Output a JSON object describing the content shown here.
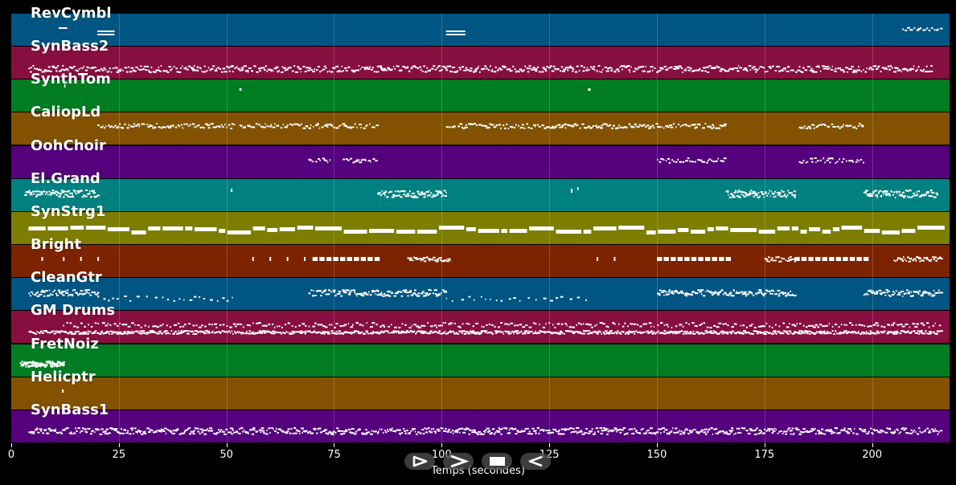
{
  "timeline": {
    "x_axis_label": "Temps (secondes)",
    "x_range": [
      0,
      218
    ],
    "ticks": [
      "0",
      "25",
      "50",
      "75",
      "100",
      "125",
      "150",
      "175",
      "200"
    ],
    "tick_values": [
      0,
      25,
      50,
      75,
      100,
      125,
      150,
      175,
      200
    ]
  },
  "tracks": [
    {
      "name": "RevCymbl",
      "color": "#005582"
    },
    {
      "name": "SynBass2",
      "color": "#870f40"
    },
    {
      "name": "SynthTom",
      "color": "#007d23"
    },
    {
      "name": "CaliopLd",
      "color": "#825200"
    },
    {
      "name": "OohChoir",
      "color": "#55007d"
    },
    {
      "name": "El.Grand",
      "color": "#008080"
    },
    {
      "name": "SynStrg1",
      "color": "#7d7d00"
    },
    {
      "name": "Bright",
      "color": "#7d2300"
    },
    {
      "name": "CleanGtr",
      "color": "#005582"
    },
    {
      "name": "GM Drums",
      "color": "#870f40"
    },
    {
      "name": "FretNoiz",
      "color": "#007d23"
    },
    {
      "name": "Helicptr",
      "color": "#825200"
    },
    {
      "name": "SynBass1",
      "color": "#55007d"
    }
  ],
  "controls": [
    {
      "name": "play-from-start-button",
      "icon": "play-outline-icon"
    },
    {
      "name": "play-button",
      "icon": "chevron-right-icon"
    },
    {
      "name": "stop-button",
      "icon": "stop-square-icon"
    },
    {
      "name": "rewind-button",
      "icon": "play-back-icon"
    }
  ]
}
